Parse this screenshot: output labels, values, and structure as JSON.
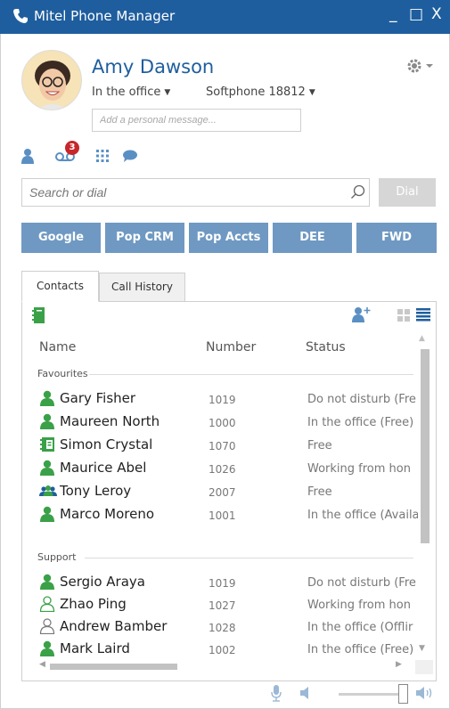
{
  "window": {
    "title": "Mitel Phone Manager",
    "minimize": "_",
    "maximize": "□",
    "close": "X"
  },
  "profile": {
    "name": "Amy Dawson",
    "presence": "In the office",
    "device": "Softphone 18812",
    "message_placeholder": "Add a personal message..."
  },
  "quick_icons": {
    "voicemail_count": "3"
  },
  "search": {
    "placeholder": "Search or dial",
    "dial_label": "Dial"
  },
  "speed_buttons": [
    "Google",
    "Pop CRM",
    "Pop Accts",
    "DEE",
    "FWD"
  ],
  "tabs": {
    "contacts": "Contacts",
    "call_history": "Call History"
  },
  "columns": {
    "name": "Name",
    "number": "Number",
    "status": "Status"
  },
  "groups": [
    {
      "name": "Favourites",
      "contacts": [
        {
          "name": "Gary Fisher",
          "number": "1019",
          "status": "Do not disturb (Fre",
          "icon": "person-green-icon"
        },
        {
          "name": "Maureen North",
          "number": "1000",
          "status": "In the office (Free)",
          "icon": "person-green-icon"
        },
        {
          "name": "Simon Crystal",
          "number": "1070",
          "status": "Free",
          "icon": "phone-book-icon"
        },
        {
          "name": "Maurice Abel",
          "number": "1026",
          "status": "Working from hon",
          "icon": "person-green-icon"
        },
        {
          "name": "Tony Leroy",
          "number": "2007",
          "status": "Free",
          "icon": "group-icon"
        },
        {
          "name": "Marco Moreno",
          "number": "1001",
          "status": "In the office (Availa",
          "icon": "person-green-icon"
        }
      ]
    },
    {
      "name": "Support",
      "contacts": [
        {
          "name": "Sergio Araya",
          "number": "1019",
          "status": "Do not disturb (Fre",
          "icon": "person-green-icon"
        },
        {
          "name": "Zhao Ping",
          "number": "1027",
          "status": "Working from hon",
          "icon": "person-outline-green-icon"
        },
        {
          "name": "Andrew Bamber",
          "number": "1028",
          "status": "In the office (Offlir",
          "icon": "person-outline-gray-icon"
        },
        {
          "name": "Mark Laird",
          "number": "1002",
          "status": "In the office (Free)",
          "icon": "person-green-icon"
        }
      ]
    }
  ],
  "colors": {
    "titlebar": "#1f5e9e",
    "speed_button": "#6f99c2",
    "presence_green": "#3aa148",
    "badge": "#c7262a"
  },
  "volume": {
    "level": 0.9
  }
}
